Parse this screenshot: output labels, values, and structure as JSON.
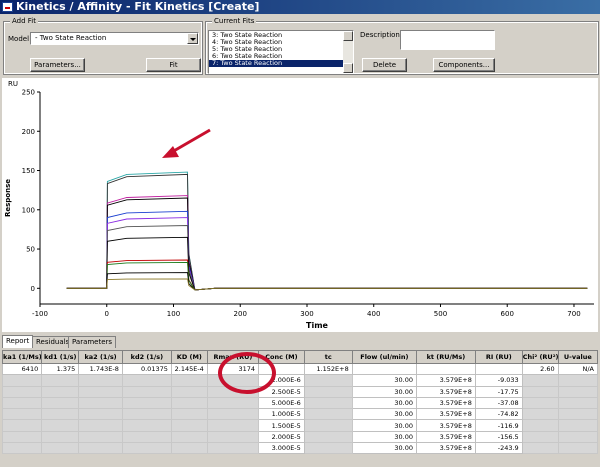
{
  "window": {
    "title": "Kinetics / Affinity - Fit Kinetics  [Create]"
  },
  "add_fit": {
    "group_title": "Add Fit",
    "model_label": "Model",
    "model_value": "  -  Two State Reaction",
    "parameters_button": "Parameters...",
    "fit_button": "Fit"
  },
  "current_fits": {
    "group_title": "Current Fits",
    "items": [
      {
        "label": "3:  Two State Reaction",
        "selected": false
      },
      {
        "label": "4:  Two State Reaction",
        "selected": false
      },
      {
        "label": "5:  Two State Reaction",
        "selected": false
      },
      {
        "label": "6:  Two State Reaction",
        "selected": false
      },
      {
        "label": "7:  Two State Reaction",
        "selected": true
      }
    ],
    "description_label": "Description",
    "description_value": "",
    "delete_button": "Delete",
    "components_button": "Components..."
  },
  "chart_data": {
    "type": "line",
    "unit_label": "RU",
    "ylabel": "Response",
    "xlabel": "Time",
    "xlim": [
      -100,
      730
    ],
    "ylim": [
      -20,
      250
    ],
    "xticks": [
      -100,
      0,
      100,
      200,
      300,
      400,
      500,
      600,
      700
    ],
    "yticks": [
      -50,
      0,
      50,
      100,
      150,
      200,
      250
    ],
    "x_tick_labels": [
      "-100",
      "0",
      "100",
      "200",
      "300",
      "400",
      "500",
      "600",
      "700"
    ],
    "y_tick_labels": [
      "-50",
      "0",
      "50",
      "100",
      "150",
      "200",
      "250"
    ],
    "x_range": [
      -60,
      720
    ],
    "injection_start": 0,
    "injection_end": 122,
    "series": [
      {
        "plateau": 148,
        "color": "#2aa7a7"
      },
      {
        "plateau": 145,
        "color": "#333333"
      },
      {
        "plateau": 118,
        "color": "#c020a0"
      },
      {
        "plateau": 115,
        "color": "#000000"
      },
      {
        "plateau": 98,
        "color": "#1a3fd0"
      },
      {
        "plateau": 90,
        "color": "#8a2be2"
      },
      {
        "plateau": 80,
        "color": "#555555"
      },
      {
        "plateau": 65,
        "color": "#000000"
      },
      {
        "plateau": 36,
        "color": "#c00000"
      },
      {
        "plateau": 33,
        "color": "#1a7a1a"
      },
      {
        "plateau": 20,
        "color": "#000000"
      },
      {
        "plateau": 12,
        "color": "#8b7a2a"
      }
    ],
    "arrow_color": "#c8102e"
  },
  "tabs": [
    {
      "label": "Report",
      "active": true
    },
    {
      "label": "Residuals",
      "active": false
    },
    {
      "label": "Parameters",
      "active": false
    }
  ],
  "report": {
    "headers": [
      "ka1 (1/Ms)",
      "kd1 (1/s)",
      "ka2 (1/s)",
      "kd2 (1/s)",
      "KD (M)",
      "Rmax (RU)",
      "Conc (M)",
      "tc",
      "Flow (ul/min)",
      "kt (RU/Ms)",
      "RI (RU)",
      "Chi² (RU²)",
      "U-value"
    ],
    "rows": [
      [
        "6410",
        "1.375",
        "1.743E-8",
        "0.01375",
        "2.145E-4",
        "3174",
        "",
        "1.152E+8",
        "",
        "",
        "",
        "2.60",
        "N/A"
      ],
      [
        "",
        "",
        "",
        "",
        "",
        "",
        "2.000E-6",
        "",
        "30.00",
        "3.579E+8",
        "-9.033",
        "",
        ""
      ],
      [
        "",
        "",
        "",
        "",
        "",
        "",
        "2.500E-5",
        "",
        "30.00",
        "3.579E+8",
        "-17.75",
        "",
        ""
      ],
      [
        "",
        "",
        "",
        "",
        "",
        "",
        "5.000E-6",
        "",
        "30.00",
        "3.579E+8",
        "-37.08",
        "",
        ""
      ],
      [
        "",
        "",
        "",
        "",
        "",
        "",
        "1.000E-5",
        "",
        "30.00",
        "3.579E+8",
        "-74.82",
        "",
        ""
      ],
      [
        "",
        "",
        "",
        "",
        "",
        "",
        "1.500E-5",
        "",
        "30.00",
        "3.579E+8",
        "-116.9",
        "",
        ""
      ],
      [
        "",
        "",
        "",
        "",
        "",
        "",
        "2.000E-5",
        "",
        "30.00",
        "3.579E+8",
        "-156.5",
        "",
        ""
      ],
      [
        "",
        "",
        "",
        "",
        "",
        "",
        "3.000E-5",
        "",
        "30.00",
        "3.579E+8",
        "-243.9",
        "",
        ""
      ]
    ],
    "white_columns_in_sub_rows": [
      6,
      8,
      9,
      10
    ]
  }
}
